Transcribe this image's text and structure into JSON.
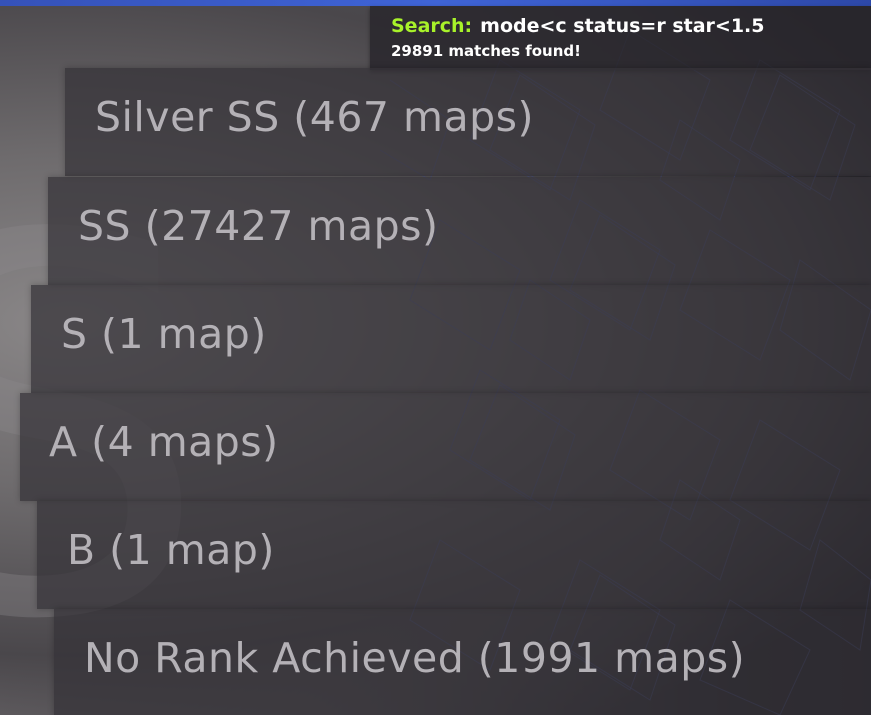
{
  "search": {
    "label": "Search:",
    "query": "mode<c status=r star<1.5",
    "matches": "29891 matches found!"
  },
  "background": {
    "letter": "S"
  },
  "groups": [
    {
      "label": "Silver SS (467 maps)"
    },
    {
      "label": "SS (27427 maps)"
    },
    {
      "label": "S (1 map)"
    },
    {
      "label": "A (4 maps)"
    },
    {
      "label": "B (1 map)"
    },
    {
      "label": "No Rank Achieved (1991 maps)"
    }
  ],
  "colors": {
    "accent_bar": "#3f64d6",
    "search_label": "#a8f22a",
    "group_text": "#b4b1b6"
  }
}
